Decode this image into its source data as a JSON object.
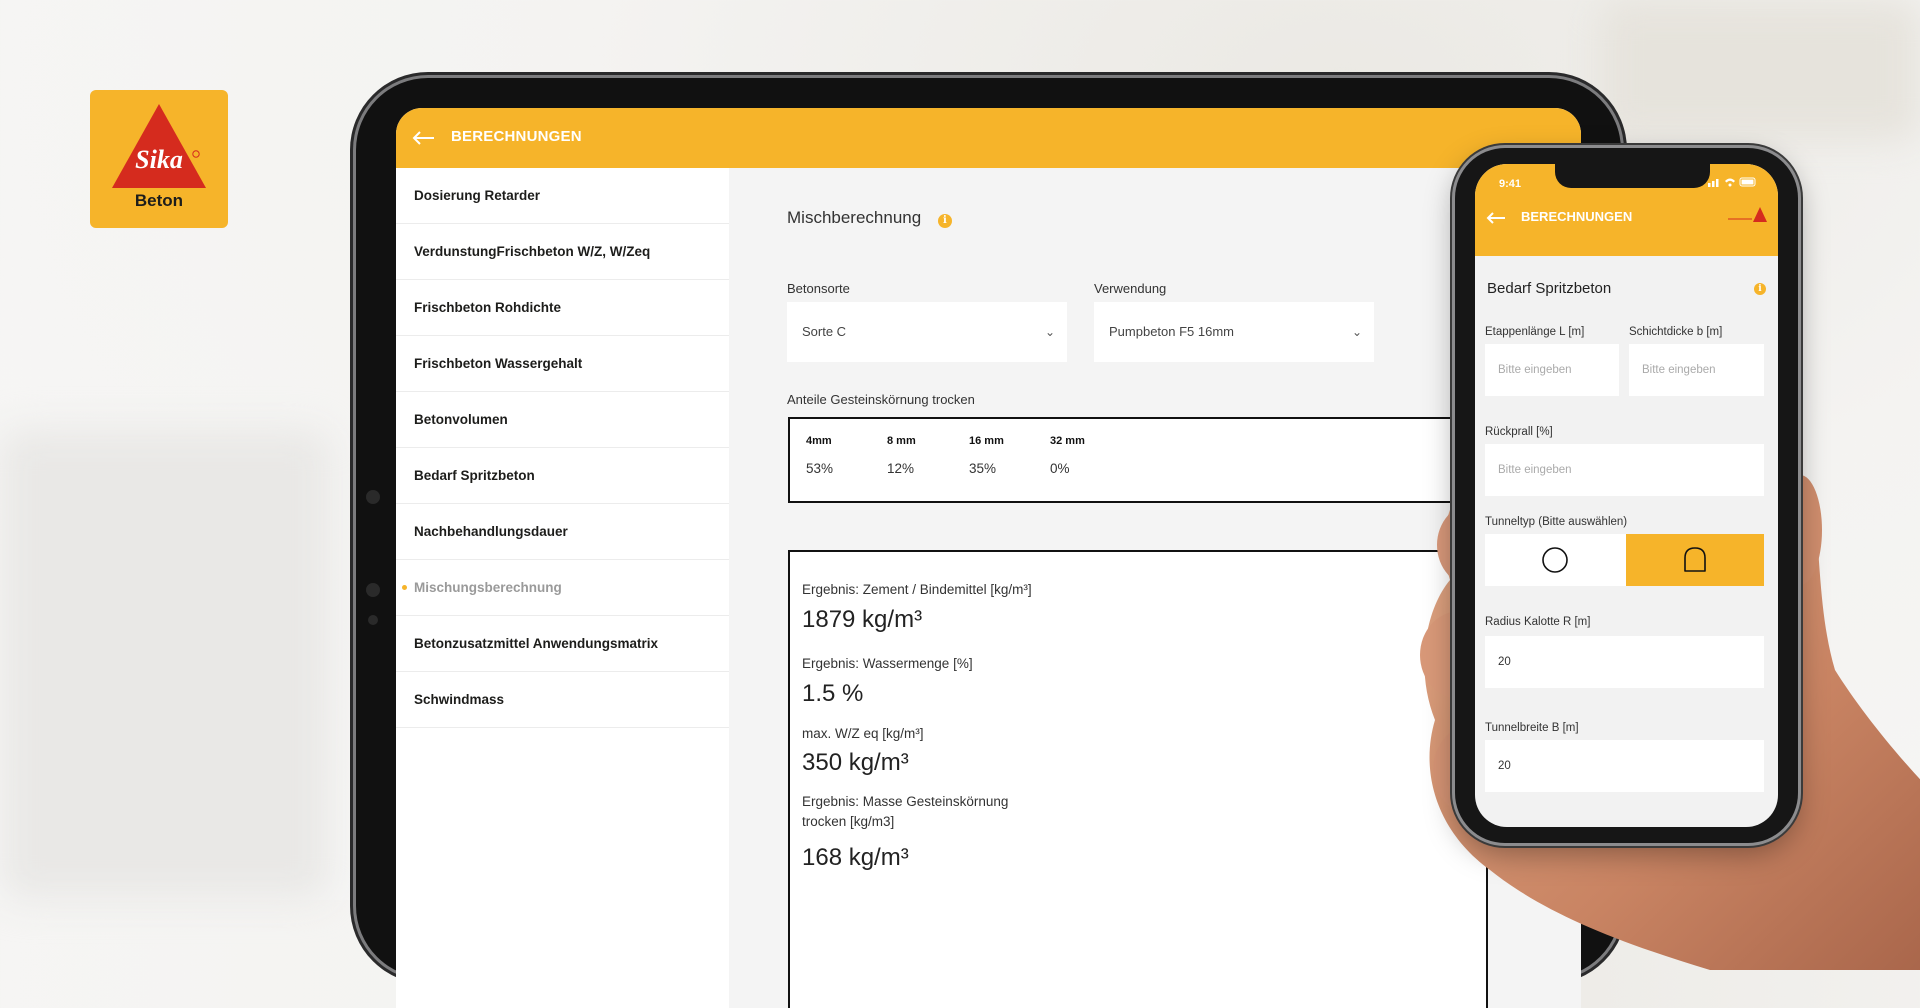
{
  "logo": {
    "brand": "Sika",
    "text": "Beton"
  },
  "tablet": {
    "header": {
      "title": "BERECHNUNGEN",
      "back_icon": "arrow-left-icon"
    },
    "sidebar": {
      "items": [
        {
          "label": "Dosierung Retarder"
        },
        {
          "label": "VerdunstungFrischbeton W/Z, W/Zeq"
        },
        {
          "label": "Frischbeton Rohdichte"
        },
        {
          "label": "Frischbeton Wassergehalt"
        },
        {
          "label": "Betonvolumen"
        },
        {
          "label": "Bedarf Spritzbeton"
        },
        {
          "label": "Nachbehandlungsdauer"
        },
        {
          "label": "Mischungsberechnung",
          "active": true
        },
        {
          "label": "Betonzusatzmittel Anwendungsmatrix"
        },
        {
          "label": "Schwindmass"
        }
      ]
    },
    "main": {
      "title": "Mischberechnung",
      "info_icon": "info-icon",
      "betonsorte": {
        "label": "Betonsorte",
        "value": "Sorte C"
      },
      "verwendung": {
        "label": "Verwendung",
        "value": "Pumpbeton F5 16mm"
      },
      "grain": {
        "label": "Anteile Gesteinskörnung trocken",
        "columns": [
          {
            "head": "4mm",
            "value": "53%"
          },
          {
            "head": "8 mm",
            "value": "12%"
          },
          {
            "head": "16 mm",
            "value": "35%"
          },
          {
            "head": "32 mm",
            "value": "0%"
          }
        ]
      },
      "results": {
        "zement_label": "Ergebnis: Zement / Bindemittel [kg/m³]",
        "zement_value": "1879 kg/m³",
        "wasser_label": "Ergebnis: Wassermenge [%]",
        "wasser_value": "1.5 %",
        "wz_label": "max. W/Z eq [kg/m³]",
        "wz_value": "350 kg/m³",
        "masse_label_1": "Ergebnis: Masse Gesteinskörnung",
        "masse_label_2": "trocken  [kg/m3]",
        "masse_value": "168 kg/m³"
      }
    }
  },
  "phone": {
    "status": {
      "time": "9:41"
    },
    "header": {
      "title": "BERECHNUNGEN"
    },
    "section_title": "Bedarf Spritzbeton",
    "etappenlaenge": {
      "label": "Etappenlänge L [m]",
      "placeholder": "Bitte eingeben"
    },
    "schichtdicke": {
      "label": "Schichtdicke b [m]",
      "placeholder": "Bitte eingeben"
    },
    "rueckprall": {
      "label": "Rückprall [%]",
      "placeholder": "Bitte eingeben"
    },
    "tunneltyp": {
      "label": "Tunneltyp (Bitte auswählen)",
      "selected": "rounded"
    },
    "radius": {
      "label": "Radius Kalotte R  [m]",
      "value": "20"
    },
    "tunnelbreite": {
      "label": "Tunnelbreite B  [m]",
      "value": "20"
    }
  },
  "colors": {
    "accent": "#f6b42a",
    "brand_red": "#d52b1e"
  }
}
